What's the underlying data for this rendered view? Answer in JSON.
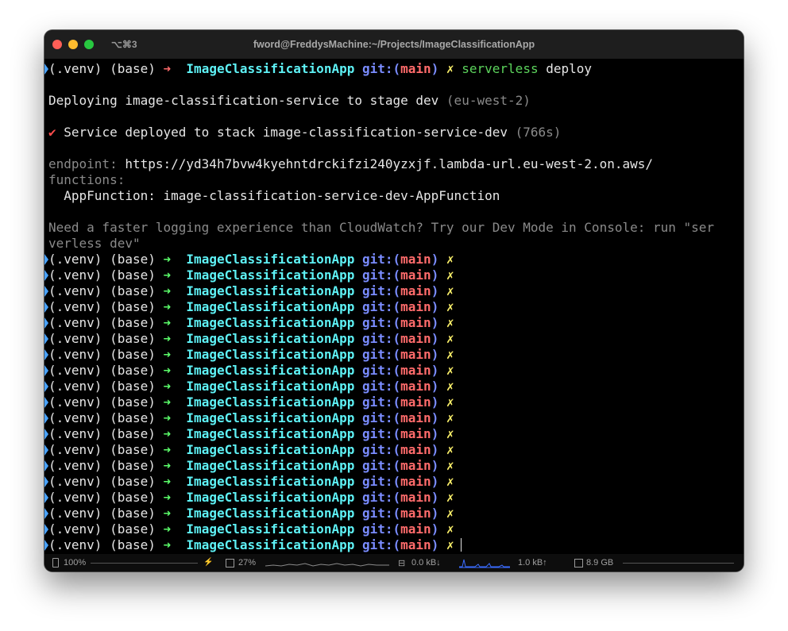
{
  "window": {
    "shortcut": "⌥⌘3",
    "title": "fword@FreddysMachine:~/Projects/ImageClassificationApp"
  },
  "prompt": {
    "venv": "(.venv)",
    "base": "(base)",
    "arrow": "➜",
    "dir": "ImageClassificationApp",
    "git_label": "git:(",
    "branch": "main",
    "git_close": ")",
    "dirty": "✗"
  },
  "first_command": {
    "cmd": "serverless",
    "args": "deploy"
  },
  "output": {
    "deploying": "Deploying image-classification-service to stage dev",
    "deploying_region": "(eu-west-2)",
    "check": "✔",
    "deployed": "Service deployed to stack image-classification-service-dev",
    "deployed_time": "(766s)",
    "endpoint_label": "endpoint:",
    "endpoint_url": "https://yd34h7bvw4kyehntdrckifzi240yzxjf.lambda-url.eu-west-2.on.aws/",
    "functions_label": "functions:",
    "function_name": "  AppFunction: image-classification-service-dev-AppFunction",
    "tip_line1": "Need a faster logging experience than CloudWatch? Try our Dev Mode in Console: run \"ser",
    "tip_line2": "verless dev\""
  },
  "repeated_prompt_count": 19,
  "status_bar": {
    "battery": "100%",
    "cpu": "27%",
    "net_down": "0.0 kB↓",
    "net_up": "1.0 kB↑",
    "memory": "8.9 GB"
  }
}
